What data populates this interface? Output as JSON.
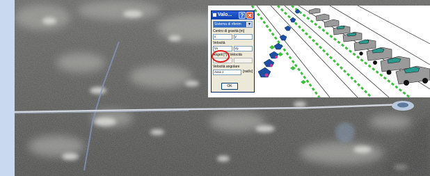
{
  "dialog": {
    "title": "Valo...",
    "help_label": "?",
    "close_label": "✕",
    "system_select_value": "Sistema di riferim",
    "center_label": "Centro di gravità [m]",
    "center_x": "x",
    "center_y": "y",
    "speed_label": "Velocità",
    "speed_x": "Vx",
    "speed_y": "Vy",
    "angles_label": "Angoli [°] / Velocità",
    "angles_a": "",
    "angles_b": "",
    "ang_speed_label": "Velocità angolare",
    "ang_speed_field": "Asse z",
    "ang_speed_unit": "[rad/s]",
    "ok_label": "OK"
  },
  "colors": {
    "highlight": "#e02020",
    "title_bar": "#0b3fb3",
    "lane_green": "#3cbf3c"
  }
}
